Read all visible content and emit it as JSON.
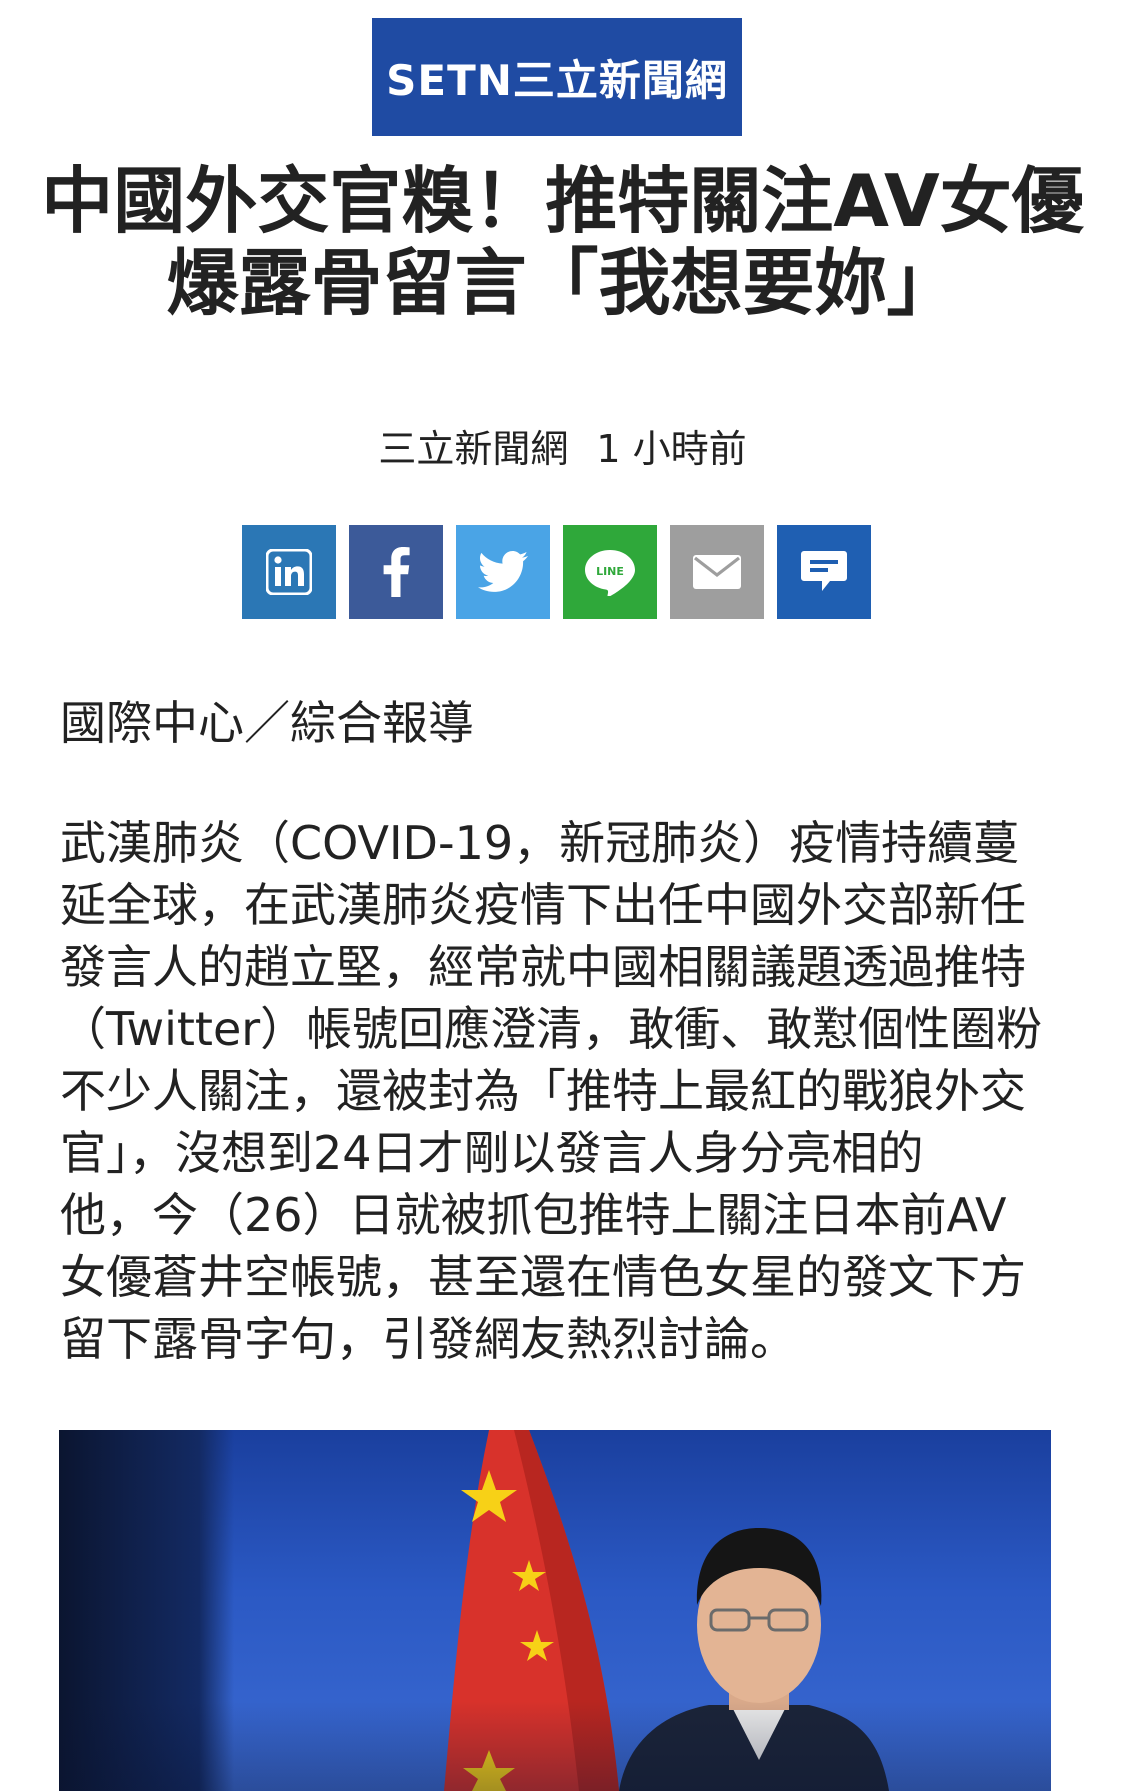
{
  "site": {
    "logo_text": "SETN三立新聞網"
  },
  "article": {
    "headline_lines": [
      "中國外交官糗！推特關注AV女優",
      "爆露骨留言「我想要妳」"
    ],
    "source": "三立新聞網",
    "time": "1 小時前",
    "byline": "國際中心／綜合報導",
    "body_lines": [
      "武漢肺炎（COVID-19，新冠肺炎）疫情持續蔓",
      "延全球，在武漢肺炎疫情下出任中國外交部新任",
      "發言人的趙立堅，經常就中國相關議題透過推特",
      "（Twitter）帳號回應澄清，敢衝、敢懟個性圈粉",
      "不少人關注，還被封為「推特上最紅的戰狼外交",
      "官」，沒想到24日才剛以發言人身分亮相的",
      "他，今（26）日就被抓包推特上關注日本前AV",
      "女優蒼井空帳號，甚至還在情色女星的發文下方",
      "留下露骨字句，引發網友熱烈討論。"
    ]
  },
  "share_buttons": [
    {
      "name": "linkedin",
      "icon": "linkedin-icon",
      "color": "#2b77b5"
    },
    {
      "name": "facebook",
      "icon": "facebook-icon",
      "color": "#3c5a99"
    },
    {
      "name": "twitter",
      "icon": "twitter-icon",
      "color": "#4aa4e6"
    },
    {
      "name": "line",
      "icon": "line-icon",
      "color": "#2fa83a"
    },
    {
      "name": "email",
      "icon": "mail-icon",
      "color": "#9e9e9e"
    },
    {
      "name": "comment",
      "icon": "comment-icon",
      "color": "#1f5fb2"
    }
  ],
  "colors": {
    "logo_bg": "#1f4ba3",
    "text": "#222222"
  }
}
